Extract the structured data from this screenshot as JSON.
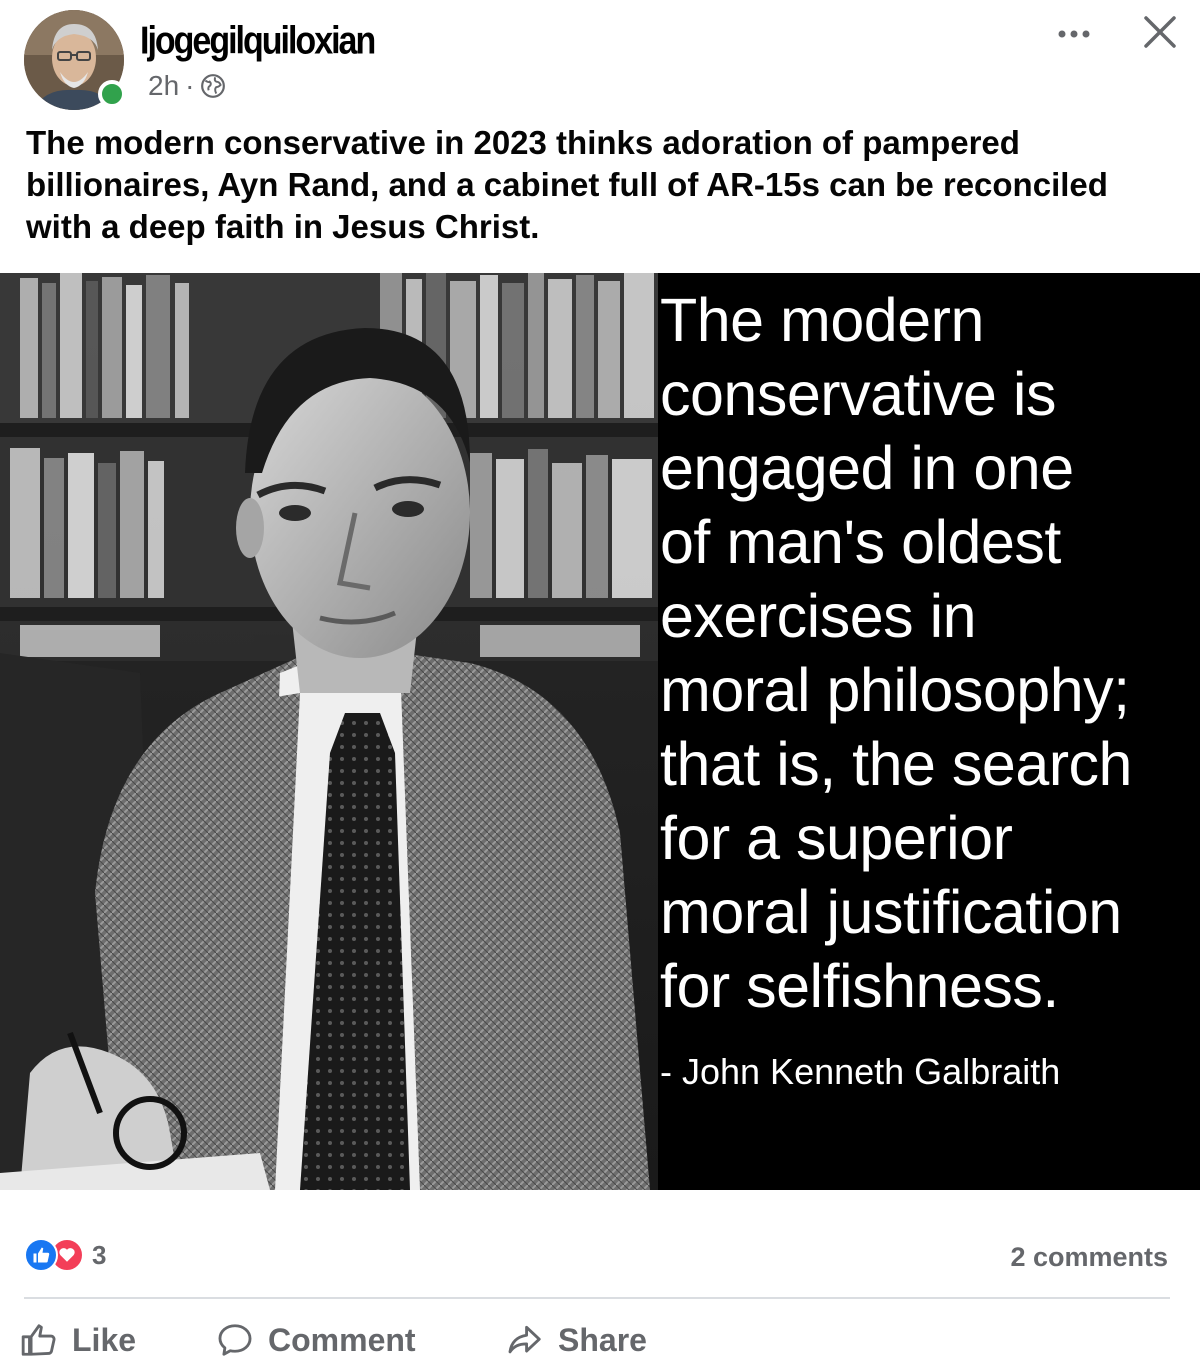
{
  "post": {
    "author": "Ijogegilquiloxian",
    "time": "2h",
    "separator": "·",
    "privacy_icon": "globe-icon",
    "text": "The modern conservative in 2023 thinks adoration of pampered billionaires, Ayn Rand, and a cabinet full of AR-15s can be reconciled with a deep faith in Jesus Christ."
  },
  "image": {
    "quote_lines": [
      "The modern",
      "conservative is",
      "engaged in one",
      "of man's oldest",
      "exercises in",
      "moral philosophy;",
      "that is, the search",
      "for a superior",
      "moral justification",
      "for selfishness."
    ],
    "attribution": "- John Kenneth Galbraith"
  },
  "stats": {
    "reaction_count": "3",
    "comments": "2 comments"
  },
  "actions": {
    "like": "Like",
    "comment": "Comment",
    "share": "Share"
  },
  "colors": {
    "like_blue": "#1877f2",
    "love_red": "#f33e58",
    "online_green": "#31a24c",
    "secondary_text": "#65676b"
  }
}
